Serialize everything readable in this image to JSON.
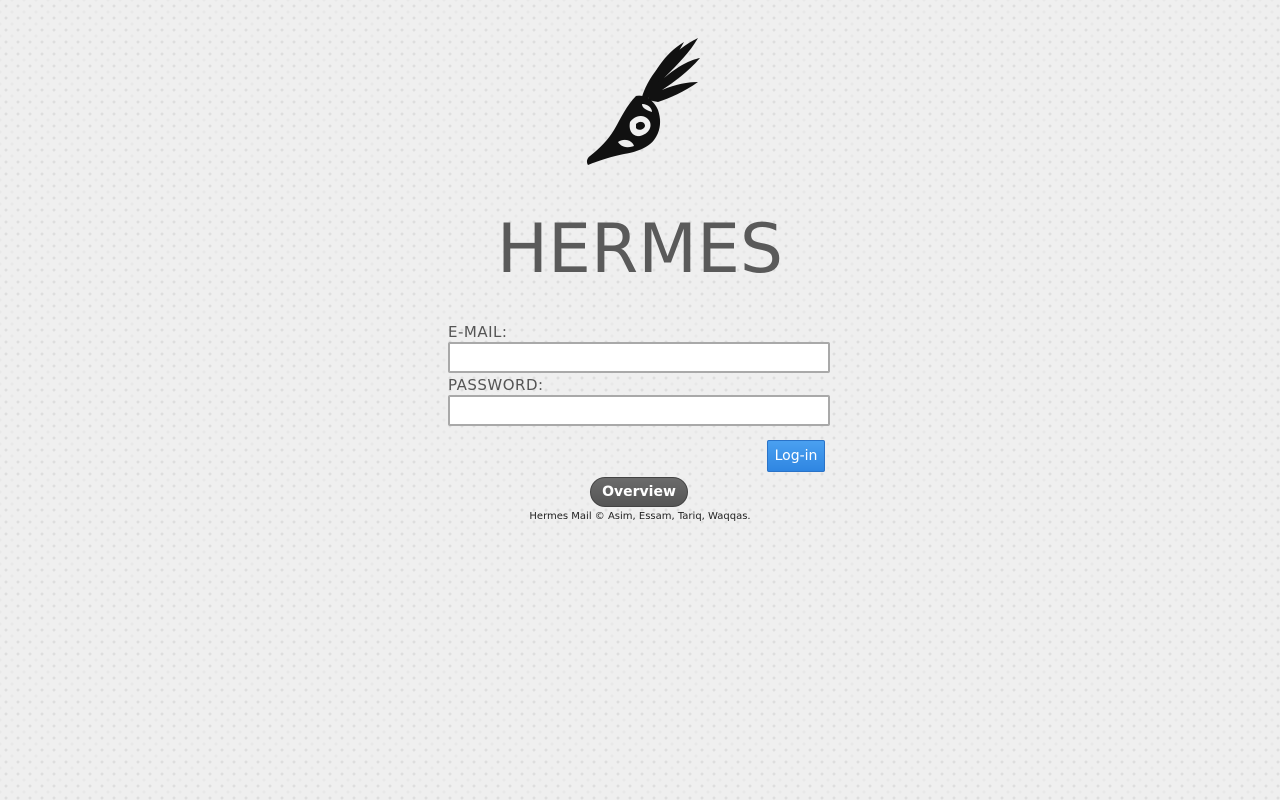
{
  "app": {
    "title": "HERMES",
    "logo_icon": "winged-shoe-icon"
  },
  "form": {
    "email_label": "E-MAIL:",
    "email_value": "",
    "password_label": "PASSWORD:",
    "password_value": "",
    "login_label": "Log-in"
  },
  "overview_label": "Overview",
  "footer": {
    "text": "Hermes Mail © Asim, Essam, Tariq, Waqqas."
  },
  "colors": {
    "background": "#efefef",
    "title": "#5a5a5a",
    "login_button": "#3a8ee6",
    "overview_button": "#5f5f5f"
  }
}
